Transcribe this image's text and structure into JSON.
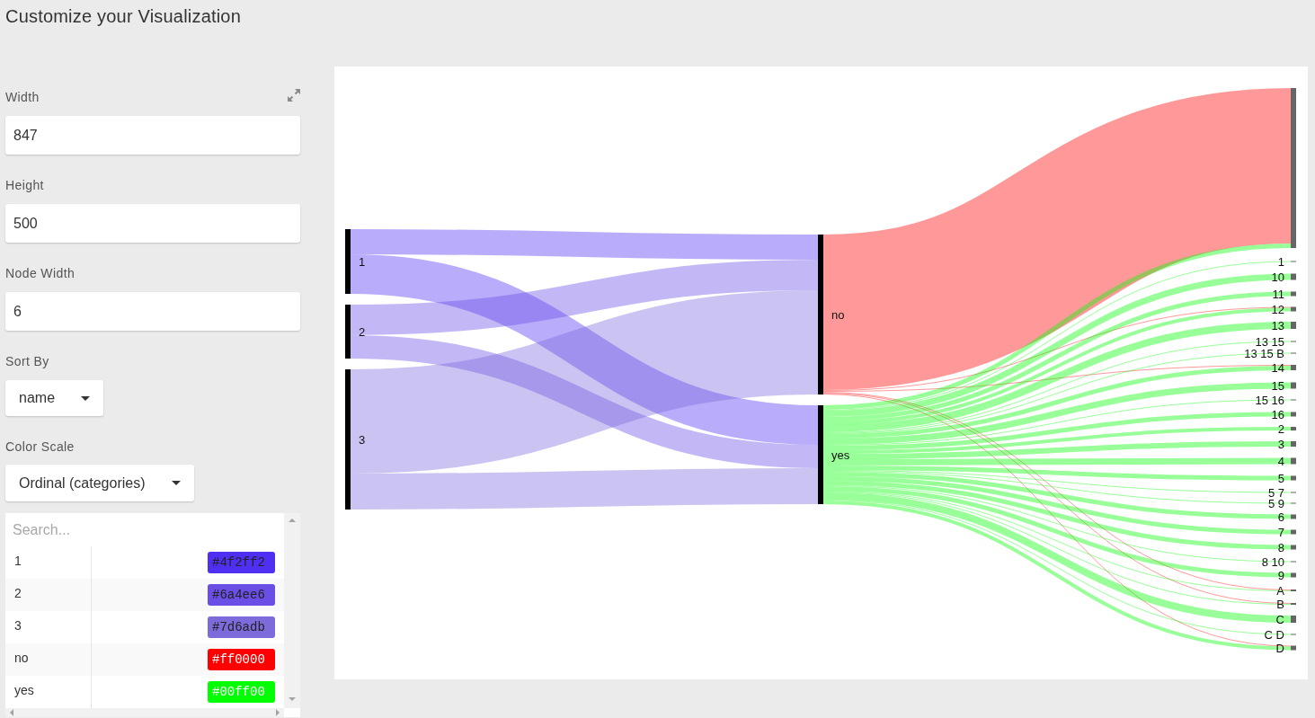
{
  "title": "Customize your Visualization",
  "fields": [
    {
      "label": "Width",
      "value": "847"
    },
    {
      "label": "Height",
      "value": "500"
    },
    {
      "label": "Node Width",
      "value": "6"
    }
  ],
  "selects": [
    {
      "label": "Sort By",
      "value": "name"
    },
    {
      "label": "Color Scale",
      "value": "Ordinal (categories)"
    }
  ],
  "color_table": {
    "search": {
      "placeholder": "Search..."
    },
    "rows": [
      {
        "name": "1",
        "value": "#4f2ff2",
        "color": "#4f2ff2"
      },
      {
        "name": "2",
        "value": "#6a4ee6",
        "color": "#6a4ee6"
      },
      {
        "name": "3",
        "value": "#7d6adb",
        "color": "#7d6adb"
      },
      {
        "name": "no",
        "value": "#ff0000",
        "color": "#ff0000"
      },
      {
        "name": "yes",
        "value": "#00ff00",
        "color": "#00ff00"
      }
    ]
  },
  "sankey": {
    "columns": [
      {
        "nodes": [
          {
            "label": "1"
          },
          {
            "label": "2"
          },
          {
            "label": "3"
          }
        ]
      },
      {
        "nodes": [
          {
            "label": "no"
          },
          {
            "label": "yes"
          }
        ]
      },
      {
        "nodes": [
          {
            "label": "1"
          },
          {
            "label": "10"
          },
          {
            "label": "11"
          },
          {
            "label": "12"
          },
          {
            "label": "13"
          },
          {
            "label": "13 15"
          },
          {
            "label": "13 15 B"
          },
          {
            "label": "14"
          },
          {
            "label": "15"
          },
          {
            "label": "15 16"
          },
          {
            "label": "16"
          },
          {
            "label": "2"
          },
          {
            "label": "3"
          },
          {
            "label": "4"
          },
          {
            "label": "5"
          },
          {
            "label": "5 7"
          },
          {
            "label": "5 9"
          },
          {
            "label": "6"
          },
          {
            "label": "7"
          },
          {
            "label": "8"
          },
          {
            "label": "8 10"
          },
          {
            "label": "9"
          },
          {
            "label": "A"
          },
          {
            "label": "B"
          },
          {
            "label": "C"
          },
          {
            "label": "C D"
          },
          {
            "label": "D"
          }
        ]
      }
    ]
  }
}
